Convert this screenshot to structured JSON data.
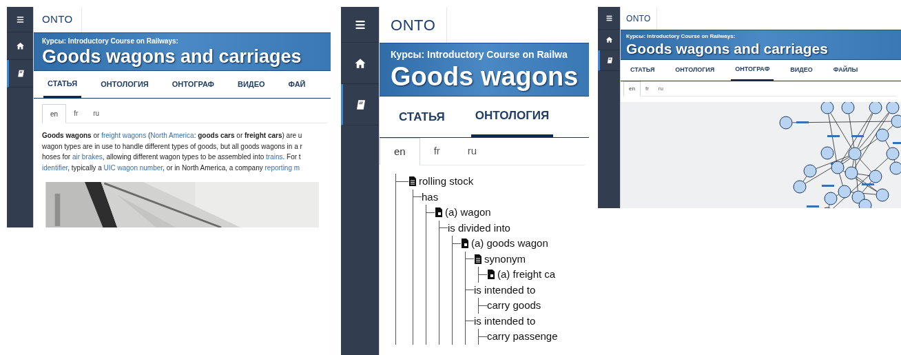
{
  "panels": [
    {
      "sidebar": [
        {
          "kind": "menu",
          "selected": false
        },
        {
          "kind": "home",
          "selected": false
        },
        {
          "kind": "book",
          "selected": true
        }
      ],
      "logo": "ONTO",
      "banner": {
        "subtitle": "Курсы: Introductory Course on Railways:",
        "title": "Goods wagons and carriages"
      },
      "tabs": [
        {
          "label": "СТАТЬЯ",
          "selected": true
        },
        {
          "label": "ОНТОЛОГИЯ",
          "selected": false
        },
        {
          "label": "ОНТОГРАФ",
          "selected": false
        },
        {
          "label": "ВИДЕО",
          "selected": false
        },
        {
          "label": "ФАЙ",
          "selected": false
        }
      ],
      "languages": [
        {
          "label": "en",
          "selected": true
        },
        {
          "label": "fr",
          "selected": false
        },
        {
          "label": "ru",
          "selected": false
        }
      ],
      "content": {
        "kind": "article",
        "lines": [
          [
            {
              "kind": "bold",
              "text": "Goods wagons"
            },
            {
              "kind": "text",
              "text": " or "
            },
            {
              "kind": "link",
              "text": "freight wagons"
            },
            {
              "kind": "text",
              "text": " ("
            },
            {
              "kind": "link",
              "text": "North America"
            },
            {
              "kind": "text",
              "text": ": "
            },
            {
              "kind": "bold",
              "text": "goods cars"
            },
            {
              "kind": "text",
              "text": " or "
            },
            {
              "kind": "bold",
              "text": "freight cars"
            },
            {
              "kind": "text",
              "text": ") are u"
            }
          ],
          [
            {
              "kind": "text",
              "text": "wagon types are in use to handle different types of goods, but all goods wagons in a r"
            }
          ],
          [
            {
              "kind": "text",
              "text": "hoses for "
            },
            {
              "kind": "link",
              "text": "air brakes"
            },
            {
              "kind": "text",
              "text": ", allowing different wagon types to be assembled into "
            },
            {
              "kind": "link",
              "text": "trains"
            },
            {
              "kind": "text",
              "text": ". For t"
            }
          ],
          [
            {
              "kind": "link",
              "text": "identifier"
            },
            {
              "kind": "text",
              "text": ", typically a "
            },
            {
              "kind": "link",
              "text": "UIC wagon number"
            },
            {
              "kind": "text",
              "text": ", or in North America, a company "
            },
            {
              "kind": "link",
              "text": "reporting m"
            }
          ]
        ]
      }
    },
    {
      "sidebar": [
        {
          "kind": "menu",
          "selected": false
        },
        {
          "kind": "home",
          "selected": false
        },
        {
          "kind": "book",
          "selected": true
        }
      ],
      "logo": "ONTO",
      "banner": {
        "subtitle": "Курсы: Introductory Course on Railwa",
        "title": "Goods wagons"
      },
      "tabs": [
        {
          "label": "СТАТЬЯ",
          "selected": false
        },
        {
          "label": "ОНТОЛОГИЯ",
          "selected": true
        }
      ],
      "languages": [
        {
          "label": "en",
          "selected": true
        },
        {
          "label": "fr",
          "selected": false
        },
        {
          "label": "ru",
          "selected": false
        }
      ],
      "content": {
        "kind": "tree",
        "nodes": [
          {
            "label": "rolling stock",
            "kind": "document",
            "children": [
              {
                "label": "has",
                "children": [
                  {
                    "label": "(a) wagon",
                    "kind": "instance",
                    "children": [
                      {
                        "label": "is divided into",
                        "children": [
                          {
                            "label": "(a) goods wagon",
                            "kind": "instance",
                            "children": [
                              {
                                "label": "synonym",
                                "kind": "document",
                                "children": [
                                  {
                                    "label": "(a) freight ca",
                                    "kind": "instance"
                                  }
                                ]
                              },
                              {
                                "label": "is intended to",
                                "children": [
                                  {
                                    "label": "carry goods"
                                  }
                                ]
                              },
                              {
                                "label": "is intended to",
                                "children": [
                                  {
                                    "label": "carry passenge"
                                  }
                                ]
                              }
                            ]
                          }
                        ]
                      }
                    ]
                  }
                ]
              }
            ]
          }
        ]
      }
    },
    {
      "sidebar": [
        {
          "kind": "menu",
          "selected": false
        },
        {
          "kind": "home",
          "selected": false
        },
        {
          "kind": "book",
          "selected": true
        }
      ],
      "logo": "ONTO",
      "banner": {
        "subtitle": "Курсы: Introductory Course on Railways:",
        "title": "Goods wagons and carriages"
      },
      "tabs": [
        {
          "label": "СТАТЬЯ",
          "selected": false
        },
        {
          "label": "ОНТОЛОГИЯ",
          "selected": false
        },
        {
          "label": "ОНТОГРАФ",
          "selected": true
        },
        {
          "label": "ВИДЕО",
          "selected": false
        },
        {
          "label": "ФАЙЛЫ",
          "selected": false
        }
      ],
      "languages": [
        {
          "label": "en",
          "selected": true
        },
        {
          "label": "fr",
          "selected": false
        },
        {
          "label": "ru",
          "selected": false
        }
      ],
      "content": {
        "kind": "graph"
      }
    }
  ]
}
